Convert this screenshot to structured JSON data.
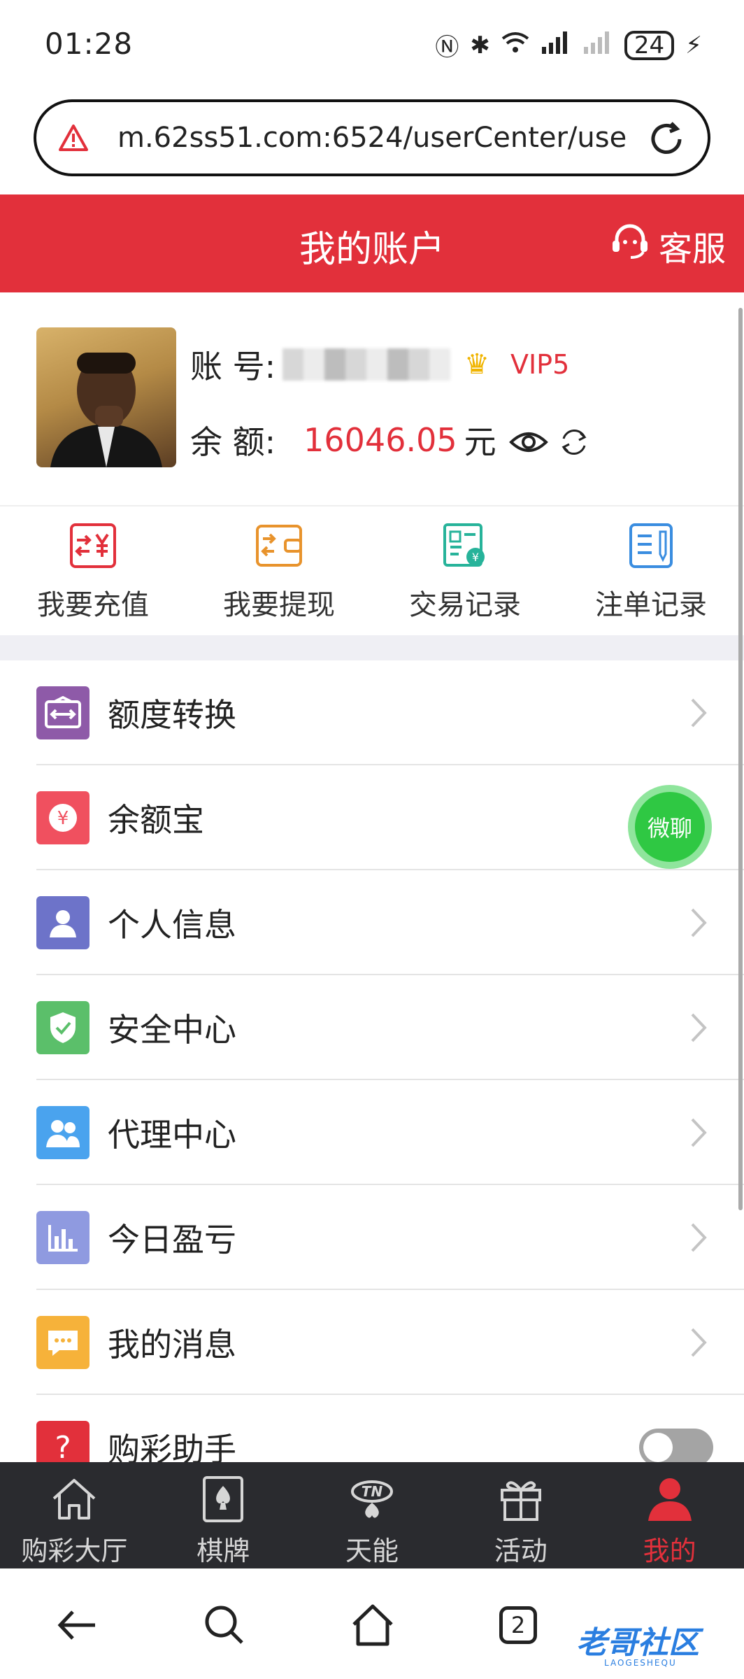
{
  "status_bar": {
    "time": "01:28",
    "battery": "24"
  },
  "browser": {
    "url": "m.62ss51.com:6524/userCenter/use"
  },
  "header": {
    "title": "我的账户",
    "service_label": "客服"
  },
  "account": {
    "account_label": "账 号:",
    "vip_level": "VIP5",
    "balance_label": "余 额:",
    "balance_value": "16046.05",
    "balance_unit": "元"
  },
  "quick_actions": [
    {
      "label": "我要充值",
      "icon": "recharge-icon",
      "color": "#e2303b"
    },
    {
      "label": "我要提现",
      "icon": "withdraw-icon",
      "color": "#e8932c"
    },
    {
      "label": "交易记录",
      "icon": "transaction-record-icon",
      "color": "#27b39a"
    },
    {
      "label": "注单记录",
      "icon": "bet-record-icon",
      "color": "#3a8de0"
    }
  ],
  "menu": [
    {
      "label": "额度转换",
      "icon": "transfer-icon",
      "color": "#8e5aa8"
    },
    {
      "label": "余额宝",
      "icon": "yuebao-icon",
      "color": "#f0505f"
    },
    {
      "label": "个人信息",
      "icon": "user-icon",
      "color": "#6d73c9"
    },
    {
      "label": "安全中心",
      "icon": "shield-icon",
      "color": "#5bbf6a"
    },
    {
      "label": "代理中心",
      "icon": "agent-icon",
      "color": "#4aa3ee"
    },
    {
      "label": "今日盈亏",
      "icon": "chart-icon",
      "color": "#8f9ae0"
    },
    {
      "label": "我的消息",
      "icon": "message-icon",
      "color": "#f6b23a"
    },
    {
      "label": "购彩助手",
      "icon": "help-icon",
      "color": "#e2303b"
    }
  ],
  "float_chat": {
    "label": "微聊"
  },
  "tabbar": [
    {
      "label": "购彩大厅",
      "icon": "home-icon"
    },
    {
      "label": "棋牌",
      "icon": "cards-icon"
    },
    {
      "label": "天能",
      "icon": "tn-icon"
    },
    {
      "label": "活动",
      "icon": "gift-icon"
    },
    {
      "label": "我的",
      "icon": "profile-icon",
      "active": true
    }
  ],
  "system_nav": {
    "tab_count": "2"
  },
  "watermark": {
    "text": "老哥社区",
    "sub": "LAOGESHEQU"
  }
}
